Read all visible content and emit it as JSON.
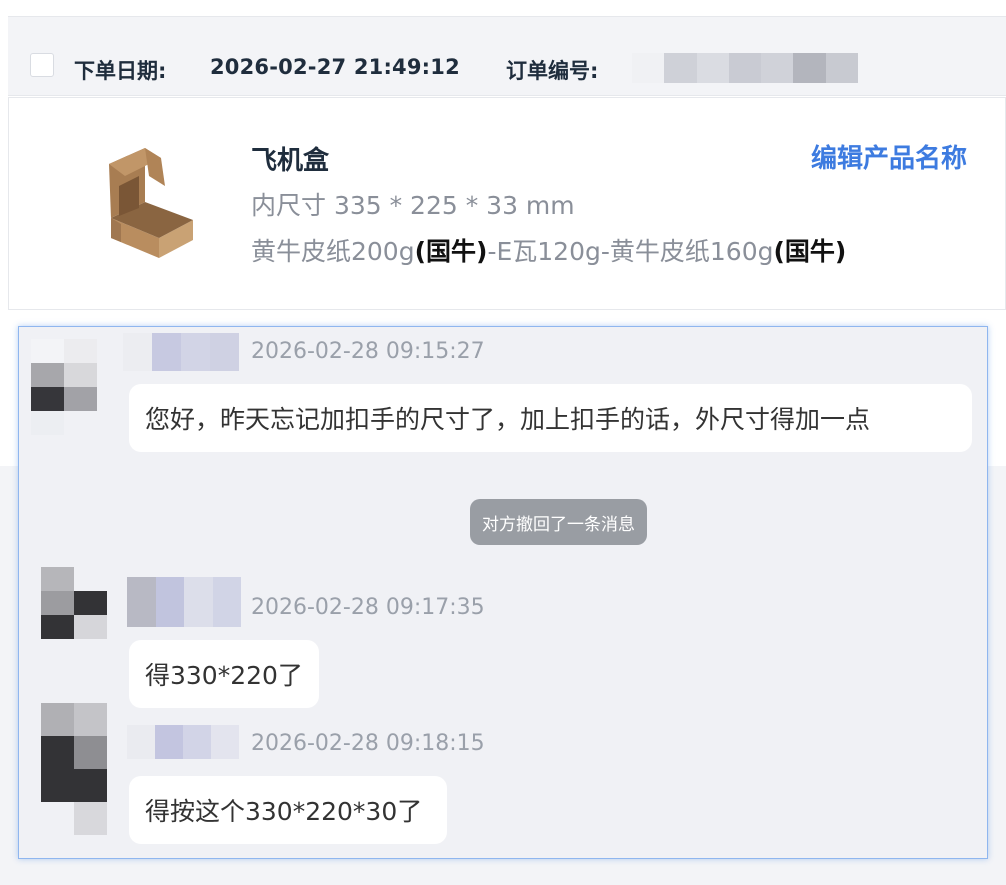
{
  "order": {
    "date_label": "下单日期:",
    "date_value": "2026-02-27 21:49:12",
    "number_label": "订单编号:"
  },
  "product": {
    "name": "飞机盒",
    "edit_label": "编辑产品名称",
    "inner_size": "内尺寸 335 * 225 * 33 mm",
    "material_parts": [
      "黄牛皮纸200g",
      "(国牛)",
      "-E瓦120g-黄牛皮纸160g",
      "(国牛)"
    ]
  },
  "chat": {
    "messages": [
      {
        "time": "2026-02-28 09:15:27",
        "text": "您好，昨天忘记加扣手的尺寸了，加上扣手的话，外尺寸得加一点"
      },
      {
        "time": "2026-02-28 09:17:35",
        "text": "得330*220了"
      },
      {
        "time": "2026-02-28 09:18:15",
        "text": "得按这个330*220*30了"
      }
    ],
    "recall_notice": "对方撤回了一条消息"
  },
  "colors": {
    "accent": "#3d7be0",
    "panel_border": "#8fb6ef",
    "text_dark": "#1f2d3d",
    "text_muted": "#8a8f99"
  }
}
